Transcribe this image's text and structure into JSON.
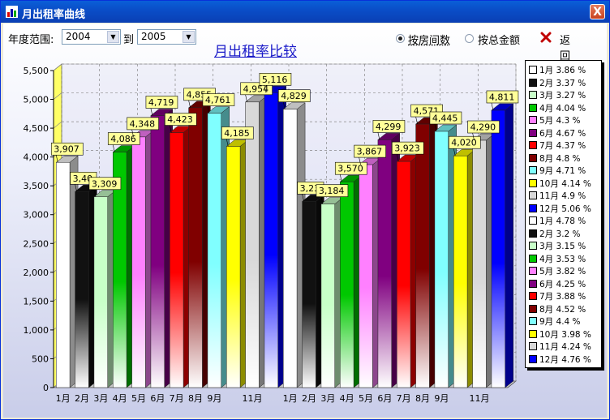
{
  "window": {
    "title": "月出租率曲线",
    "close_label": "X"
  },
  "toolbar": {
    "range_label": "年度范围:",
    "from_year": "2004",
    "to_label": "到",
    "to_year": "2005",
    "radio_rooms": "按房间数",
    "radio_amount": "按总金额",
    "back_label": "返 回"
  },
  "chart_data": {
    "type": "bar",
    "title": "月出租率比较",
    "ylim": [
      0,
      5500
    ],
    "yticks": [
      0,
      500,
      1000,
      1500,
      2000,
      2500,
      3000,
      3500,
      4000,
      4500,
      5000,
      5500
    ],
    "ytick_labels": [
      "0",
      "500",
      "1,000",
      "1,500",
      "2,000",
      "2,500",
      "3,000",
      "3,500",
      "4,000",
      "4,500",
      "5,000",
      "5,500"
    ],
    "categories": [
      "1月",
      "2月",
      "3月",
      "4月",
      "5月",
      "6月",
      "7月",
      "8月",
      "9月",
      "10月",
      "11月",
      "12月",
      "1月",
      "2月",
      "3月",
      "4月",
      "5月",
      "6月",
      "7月",
      "8月",
      "9月",
      "10月",
      "11月",
      "12月"
    ],
    "x_labels": [
      "1月",
      "2月",
      "3月",
      "4月",
      "5月",
      "6月",
      "7月",
      "8月",
      "9月",
      "",
      "11月",
      "",
      "1月",
      "2月",
      "3月",
      "4月",
      "5月",
      "6月",
      "7月",
      "8月",
      "9月",
      "",
      "11月",
      ""
    ],
    "values": [
      3907,
      3400,
      3309,
      4086,
      4348,
      4719,
      4423,
      4855,
      4761,
      4185,
      4954,
      5116,
      4829,
      3230,
      3184,
      3570,
      3867,
      4299,
      3923,
      4571,
      4445,
      4020,
      4290,
      4811
    ],
    "value_labels": [
      "3,907",
      "3,40",
      "3,309",
      "4,086",
      "4,348",
      "4,719",
      "4,423",
      "4,855",
      "4,761",
      "4,185",
      "4,954",
      "5,116",
      "4,829",
      "3,23",
      "3,184",
      "3,570",
      "3,867",
      "4,299",
      "3,923",
      "4,571",
      "4,445",
      "4,020",
      "4,290",
      "4,811"
    ],
    "colors": [
      "#ffffff",
      "#111111",
      "#c8ffc8",
      "#00c800",
      "#ff80ff",
      "#800080",
      "#ff0000",
      "#800000",
      "#80ffff",
      "#ffff00",
      "#d8d8d8",
      "#0000ff",
      "#ffffff",
      "#111111",
      "#c8ffc8",
      "#00c800",
      "#ff80ff",
      "#800080",
      "#ff0000",
      "#800000",
      "#80ffff",
      "#ffff00",
      "#d8d8d8",
      "#0000ff"
    ],
    "grid": true,
    "legend_position": "right"
  },
  "legend": {
    "items": [
      "1月 3.86 %",
      "2月 3.37 %",
      "3月 3.27 %",
      "4月 4.04 %",
      "5月 4.3 %",
      "6月 4.67 %",
      "7月 4.37 %",
      "8月 4.8 %",
      "9月 4.71 %",
      "10月 4.14 %",
      "11月 4.9 %",
      "12月 5.06 %",
      "1月 4.78 %",
      "2月 3.2 %",
      "3月 3.15 %",
      "4月 3.53 %",
      "5月 3.82 %",
      "6月 4.25 %",
      "7月 3.88 %",
      "8月 4.52 %",
      "9月 4.4 %",
      "10月 3.98 %",
      "11月 4.24 %",
      "12月 4.76 %"
    ]
  }
}
